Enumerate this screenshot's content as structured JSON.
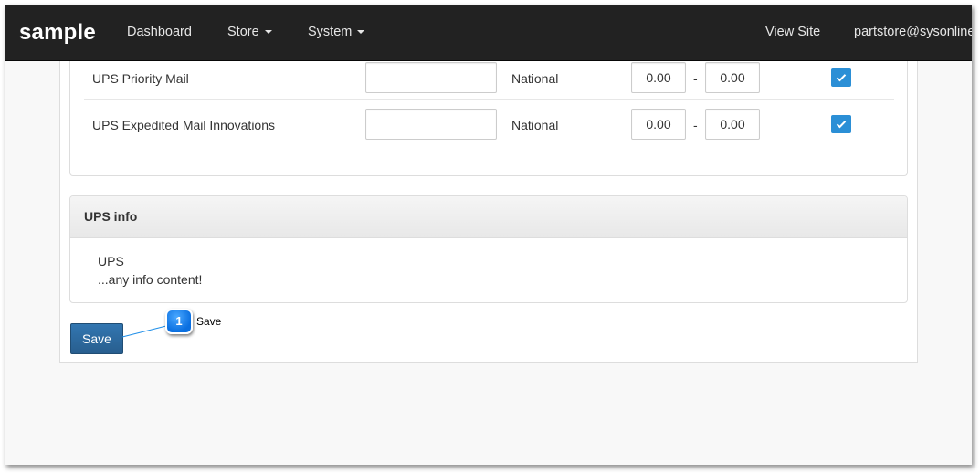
{
  "navbar": {
    "brand": "sample",
    "items": [
      {
        "label": "Dashboard"
      },
      {
        "label": "Store"
      },
      {
        "label": "System"
      }
    ],
    "view_site": "View Site",
    "user": "partstore@sysonline"
  },
  "shipping_methods": [
    {
      "name": "UPS Priority Mail",
      "zone": "National",
      "min": "0.00",
      "max": "0.00",
      "range_separator": "-",
      "enabled": true
    },
    {
      "name": "UPS Expedited Mail Innovations",
      "zone": "National",
      "min": "0.00",
      "max": "0.00",
      "range_separator": "-",
      "enabled": true
    }
  ],
  "info_panel": {
    "title": "UPS info",
    "lines": [
      "UPS",
      "...any info content!"
    ]
  },
  "save_label": "Save",
  "callout": {
    "number": "1",
    "label": "Save"
  },
  "colors": {
    "navbar": "#222222",
    "primary_button": "#3276b1",
    "checkbox": "#2b8fd6",
    "callout": "#0a6fe0"
  }
}
